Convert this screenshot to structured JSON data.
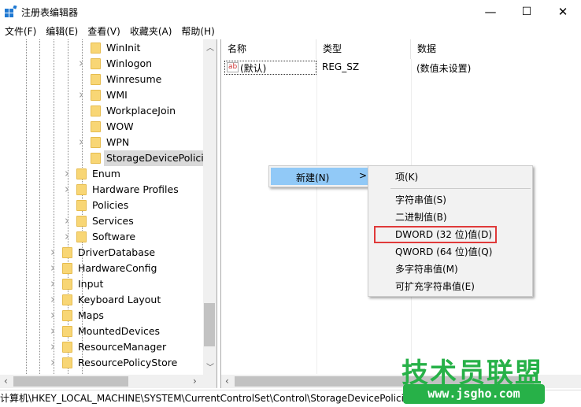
{
  "window": {
    "title": "注册表编辑器",
    "minimize_icon": "minimize-icon",
    "maximize_icon": "maximize-icon",
    "close_icon": "close-icon"
  },
  "menubar": [
    "文件(F)",
    "编辑(E)",
    "查看(V)",
    "收藏夹(A)",
    "帮助(H)"
  ],
  "tree": [
    {
      "label": "WinInit",
      "level": 3,
      "arrow": false
    },
    {
      "label": "Winlogon",
      "level": 3,
      "arrow": true
    },
    {
      "label": "Winresume",
      "level": 3,
      "arrow": false
    },
    {
      "label": "WMI",
      "level": 3,
      "arrow": true
    },
    {
      "label": "WorkplaceJoin",
      "level": 3,
      "arrow": false
    },
    {
      "label": "WOW",
      "level": 3,
      "arrow": false
    },
    {
      "label": "WPN",
      "level": 3,
      "arrow": true
    },
    {
      "label": "StorageDevicePolicies",
      "level": 3,
      "arrow": false,
      "selected": true
    },
    {
      "label": "Enum",
      "level": 2,
      "arrow": true
    },
    {
      "label": "Hardware Profiles",
      "level": 2,
      "arrow": true
    },
    {
      "label": "Policies",
      "level": 2,
      "arrow": false
    },
    {
      "label": "Services",
      "level": 2,
      "arrow": true
    },
    {
      "label": "Software",
      "level": 2,
      "arrow": true
    },
    {
      "label": "DriverDatabase",
      "level": 1,
      "arrow": true
    },
    {
      "label": "HardwareConfig",
      "level": 1,
      "arrow": true
    },
    {
      "label": "Input",
      "level": 1,
      "arrow": true
    },
    {
      "label": "Keyboard Layout",
      "level": 1,
      "arrow": true
    },
    {
      "label": "Maps",
      "level": 1,
      "arrow": true
    },
    {
      "label": "MountedDevices",
      "level": 1,
      "arrow": true
    },
    {
      "label": "ResourceManager",
      "level": 1,
      "arrow": true
    },
    {
      "label": "ResourcePolicyStore",
      "level": 1,
      "arrow": true
    }
  ],
  "columns": {
    "name": "名称",
    "type": "类型",
    "data": "数据"
  },
  "values": [
    {
      "icon": "ab",
      "name": "(默认)",
      "type": "REG_SZ",
      "data": "(数值未设置)"
    }
  ],
  "context_menu": {
    "new_label": "新建(N)",
    "new_arrow": ">"
  },
  "submenu": [
    "项(K)",
    "字符串值(S)",
    "二进制值(B)",
    "DWORD (32 位)值(D)",
    "QWORD (64 位)值(Q)",
    "多字符串值(M)",
    "可扩充字符串值(E)"
  ],
  "highlight_color": "#e03a3a",
  "status": "计算机\\HKEY_LOCAL_MACHINE\\SYSTEM\\CurrentControlSet\\Control\\StorageDevicePolicies",
  "watermark": {
    "title": "技术员联盟",
    "url": "www.jsgho.com"
  }
}
